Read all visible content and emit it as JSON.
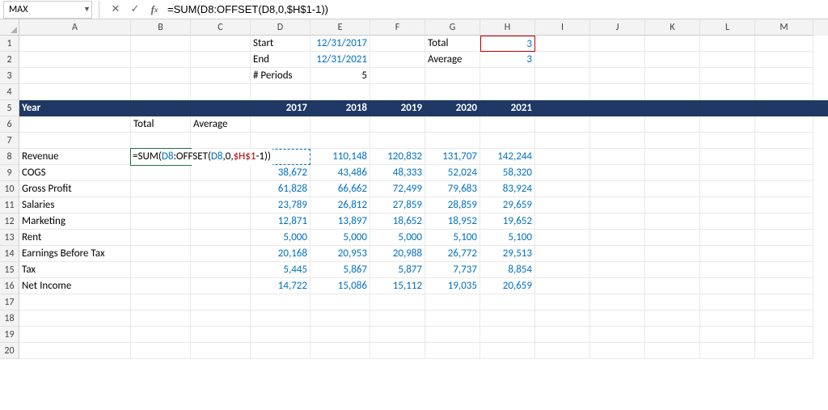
{
  "formula_bar": {
    "name_box": "MAX",
    "formula": "=SUM(D8:OFFSET(D8,0,$H$1-1))"
  },
  "columns": [
    "A",
    "B",
    "C",
    "D",
    "E",
    "F",
    "G",
    "H",
    "I",
    "J",
    "K",
    "L",
    "M"
  ],
  "header_cells": {
    "D1": "Start",
    "E1": "12/31/2017",
    "G1": "Total",
    "H1": "3",
    "D2": "End",
    "E2": "12/31/2021",
    "G2": "Average",
    "H2": "3",
    "D3": "# Periods",
    "E3": "5"
  },
  "row5": {
    "A": "Year",
    "D": "2017",
    "E": "2018",
    "F": "2019",
    "G": "2020",
    "H": "2021"
  },
  "row6": {
    "B": "Total",
    "C": "Average"
  },
  "row8_formula_tokens": [
    {
      "t": "=SUM(",
      "c": "kw"
    },
    {
      "t": "D8",
      "c": "ref-blue"
    },
    {
      "t": ":OFFSET(",
      "c": "kw"
    },
    {
      "t": "D8",
      "c": "ref-blue"
    },
    {
      "t": ",0,",
      "c": "kw"
    },
    {
      "t": "$H$1",
      "c": "ref-red"
    },
    {
      "t": "-1))",
      "c": "kw"
    }
  ],
  "table": {
    "labels": {
      "8": "Revenue",
      "9": "COGS",
      "10": "Gross Profit",
      "11": "Salaries",
      "12": "Marketing",
      "13": "Rent",
      "14": "Earnings Before Tax",
      "15": "Tax",
      "16": "Net Income"
    },
    "values": {
      "8": {
        "E": "110,148",
        "F": "120,832",
        "G": "131,707",
        "H": "142,244"
      },
      "9": {
        "D": "38,672",
        "E": "43,486",
        "F": "48,333",
        "G": "52,024",
        "H": "58,320"
      },
      "10": {
        "D": "61,828",
        "E": "66,662",
        "F": "72,499",
        "G": "79,683",
        "H": "83,924"
      },
      "11": {
        "D": "23,789",
        "E": "26,812",
        "F": "27,859",
        "G": "28,859",
        "H": "29,659"
      },
      "12": {
        "D": "12,871",
        "E": "13,897",
        "F": "18,652",
        "G": "18,952",
        "H": "19,652"
      },
      "13": {
        "D": "5,000",
        "E": "5,000",
        "F": "5,000",
        "G": "5,100",
        "H": "5,100"
      },
      "14": {
        "D": "20,168",
        "E": "20,953",
        "F": "20,988",
        "G": "26,772",
        "H": "29,513"
      },
      "15": {
        "D": "5,445",
        "E": "5,867",
        "F": "5,877",
        "G": "7,737",
        "H": "8,854"
      },
      "16": {
        "D": "14,722",
        "E": "15,086",
        "F": "15,112",
        "G": "19,035",
        "H": "20,659"
      }
    }
  },
  "chart_data": {
    "type": "table",
    "title": "Year",
    "categories": [
      "2017",
      "2018",
      "2019",
      "2020",
      "2021"
    ],
    "series": [
      {
        "name": "Revenue",
        "values": [
          null,
          110148,
          120832,
          131707,
          142244
        ]
      },
      {
        "name": "COGS",
        "values": [
          38672,
          43486,
          48333,
          52024,
          58320
        ]
      },
      {
        "name": "Gross Profit",
        "values": [
          61828,
          66662,
          72499,
          79683,
          83924
        ]
      },
      {
        "name": "Salaries",
        "values": [
          23789,
          26812,
          27859,
          28859,
          29659
        ]
      },
      {
        "name": "Marketing",
        "values": [
          12871,
          13897,
          18652,
          18952,
          19652
        ]
      },
      {
        "name": "Rent",
        "values": [
          5000,
          5000,
          5000,
          5100,
          5100
        ]
      },
      {
        "name": "Earnings Before Tax",
        "values": [
          20168,
          20953,
          20988,
          26772,
          29513
        ]
      },
      {
        "name": "Tax",
        "values": [
          5445,
          5867,
          5877,
          7737,
          8854
        ]
      },
      {
        "name": "Net Income",
        "values": [
          14722,
          15086,
          15112,
          19035,
          20659
        ]
      }
    ]
  }
}
